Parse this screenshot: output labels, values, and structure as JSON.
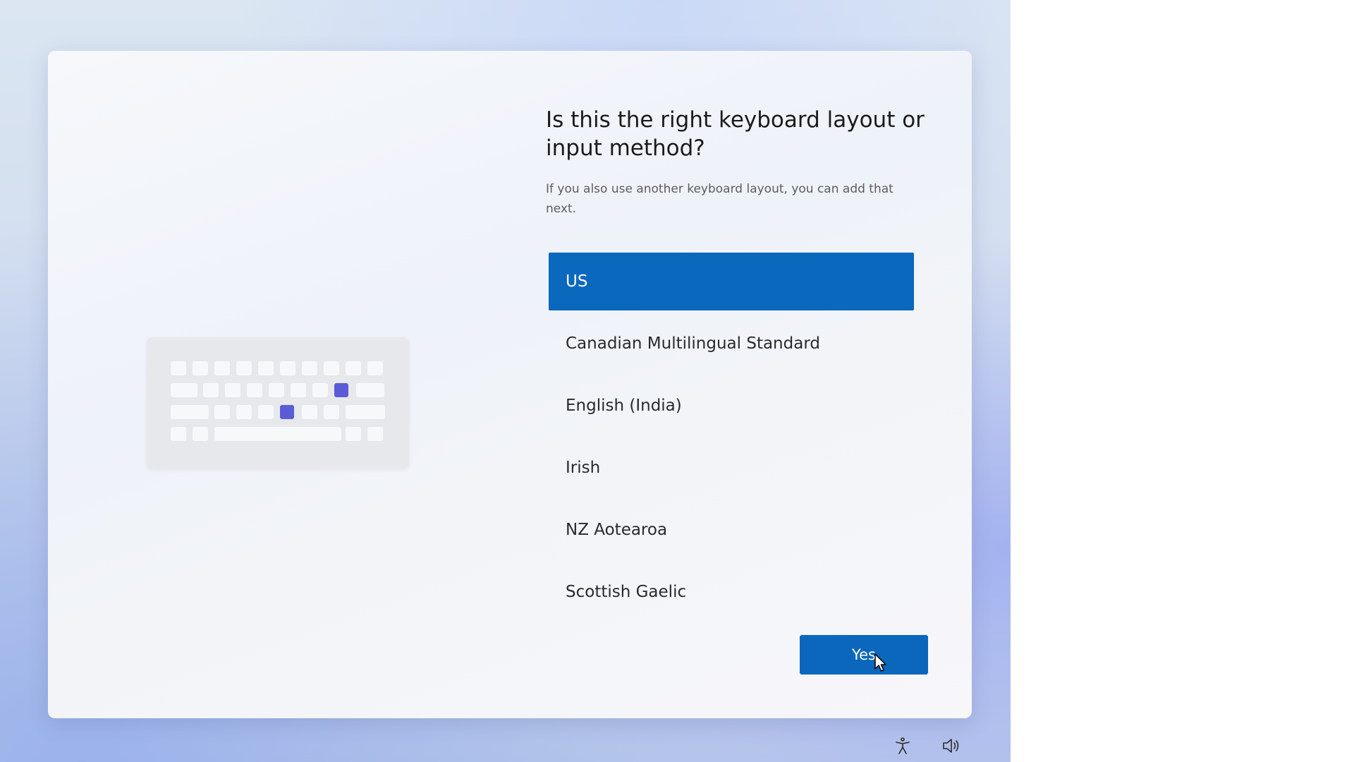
{
  "dialog": {
    "heading": "Is this the right keyboard layout or input method?",
    "subtext": "If you also use another keyboard layout, you can add that next."
  },
  "layouts": {
    "items": [
      {
        "label": "US",
        "selected": true
      },
      {
        "label": "Canadian Multilingual Standard",
        "selected": false
      },
      {
        "label": "English (India)",
        "selected": false
      },
      {
        "label": "Irish",
        "selected": false
      },
      {
        "label": "NZ Aotearoa",
        "selected": false
      },
      {
        "label": "Scottish Gaelic",
        "selected": false
      }
    ]
  },
  "actions": {
    "yes_label": "Yes"
  },
  "system_tray": {
    "icons": [
      "accessibility-icon",
      "volume-icon"
    ]
  },
  "colors": {
    "accent": "#0a68bd",
    "keyboard_highlight": "#5b5bd6"
  }
}
